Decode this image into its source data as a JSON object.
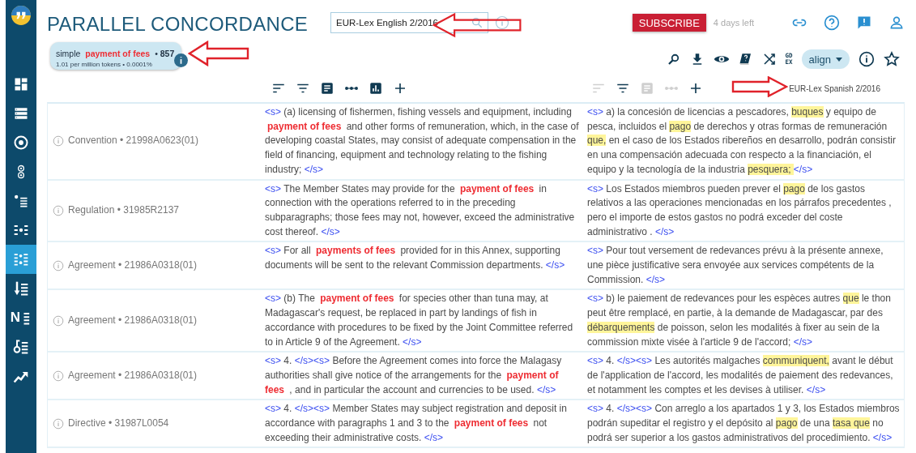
{
  "sidebar": {
    "items": [
      {
        "selected": false
      },
      {
        "selected": false
      },
      {
        "selected": false
      },
      {
        "selected": false
      },
      {
        "selected": false
      },
      {
        "selected": false
      },
      {
        "selected": true
      },
      {
        "selected": false
      },
      {
        "selected": false,
        "glyph": "N"
      },
      {
        "selected": false
      },
      {
        "selected": false
      }
    ]
  },
  "header": {
    "title": "PARALLEL CONCORDANCE",
    "search": {
      "value": "EUR-Lex English 2/2016"
    },
    "subscribe": "SUBSCRIBE",
    "trial": "4 days left"
  },
  "stats": {
    "line1": [
      {
        "kind": "plain",
        "text": "simple "
      },
      {
        "kind": "hit",
        "text": "payment of fees"
      },
      {
        "kind": "plain",
        "text": " • "
      },
      {
        "kind": "bold",
        "text": "857"
      }
    ],
    "line2": "1.01 per million tokens • 0.0001%"
  },
  "tools": {
    "gdex": [
      "GD",
      "EX"
    ],
    "align": "align"
  },
  "toolbars": {
    "left": [
      {
        "disabled": false
      },
      {
        "disabled": false
      },
      {
        "disabled": false
      },
      {
        "disabled": false
      },
      {
        "disabled": false
      },
      {
        "disabled": false
      }
    ],
    "right": [
      {
        "disabled": true
      },
      {
        "disabled": false
      },
      {
        "disabled": true
      },
      {
        "disabled": true
      },
      {
        "disabled": false
      }
    ],
    "right_corpus": "EUR-Lex Spanish 2/2016"
  },
  "rows": [
    {
      "doc": "Convention • 21998A0623(01)",
      "source": [
        {
          "kind": "tag",
          "text": "<s>"
        },
        {
          "kind": "text",
          "text": " (a) licensing of fishermen, fishing vessels and equipment, including "
        },
        {
          "kind": "hit",
          "text": "payment of fees"
        },
        {
          "kind": "text",
          "text": " and other forms of remuneration, which, in the case of developing coastal States, may consist of adequate compensation in the field of financing, equipment and technology relating to the fishing industry; "
        },
        {
          "kind": "tag",
          "text": "</s>"
        }
      ],
      "target": [
        {
          "kind": "tag",
          "text": "<s>"
        },
        {
          "kind": "text",
          "text": "  a) la concesión de licencias a pescadores, "
        },
        {
          "kind": "mark",
          "text": "buques"
        },
        {
          "kind": "text",
          "text": " y equipo de pesca, incluidos el "
        },
        {
          "kind": "mark",
          "text": "pago"
        },
        {
          "kind": "text",
          "text": " de derechos y otras formas de remuneración "
        },
        {
          "kind": "mark",
          "text": "que,"
        },
        {
          "kind": "text",
          "text": " en el caso de los Estados ribereños en desarrollo, podrán consistir en una compensación adecuada con respecto a la financiación, el equipo y la tecnología de la industria "
        },
        {
          "kind": "mark",
          "text": "pesquera; "
        },
        {
          "kind": "tag",
          "text": "</s>"
        }
      ]
    },
    {
      "doc": "Regulation • 31985R2137",
      "source": [
        {
          "kind": "tag",
          "text": "<s>"
        },
        {
          "kind": "text",
          "text": " The Member States may provide for the "
        },
        {
          "kind": "hit",
          "text": "payment of fees"
        },
        {
          "kind": "text",
          "text": " in connection with the operations referred to in the preceding subparagraphs; those fees may not, however, exceed the administrative cost thereof. "
        },
        {
          "kind": "tag",
          "text": "</s>"
        }
      ],
      "target": [
        {
          "kind": "tag",
          "text": "<s>"
        },
        {
          "kind": "text",
          "text": "  Los Estados miembros pueden prever el "
        },
        {
          "kind": "mark",
          "text": "pago"
        },
        {
          "kind": "text",
          "text": " de los gastos relativos a las operaciones mencionadas en los párrafos precedentes , pero el importe de estos gastos no podrá exceder del coste administrativo .  "
        },
        {
          "kind": "tag",
          "text": "</s>"
        }
      ]
    },
    {
      "doc": "Agreement • 21986A0318(01)",
      "source": [
        {
          "kind": "tag",
          "text": "<s>"
        },
        {
          "kind": "text",
          "text": " For all "
        },
        {
          "kind": "hit",
          "text": "payments of fees"
        },
        {
          "kind": "text",
          "text": " provided for in this Annex, supporting documents will be sent to the relevant Commission departments. "
        },
        {
          "kind": "tag",
          "text": "</s>"
        }
      ],
      "target": [
        {
          "kind": "tag",
          "text": "<s>"
        },
        {
          "kind": "text",
          "text": "  Pour tout versement de redevances prévu à la présente annexe, une pièce justificative sera envoyée aux services compétents de la Commission.  "
        },
        {
          "kind": "tag",
          "text": "</s>"
        }
      ]
    },
    {
      "doc": "Agreement • 21986A0318(01)",
      "source": [
        {
          "kind": "tag",
          "text": "<s>"
        },
        {
          "kind": "text",
          "text": " (b) The "
        },
        {
          "kind": "hit",
          "text": "payment of fees"
        },
        {
          "kind": "text",
          "text": " for species other than tuna may, at Madagascar's request, be replaced in part by landings of fish in accordance with procedures to be fixed by the Joint Committee referred to in Article 9 of the Agreement. "
        },
        {
          "kind": "tag",
          "text": "</s>"
        }
      ],
      "target": [
        {
          "kind": "tag",
          "text": "<s>"
        },
        {
          "kind": "text",
          "text": "  b) le paiement de redevances pour les espèces autres "
        },
        {
          "kind": "mark",
          "text": "que"
        },
        {
          "kind": "text",
          "text": " le thon peut être remplacé, en partie, à la demande de Madagascar, par des "
        },
        {
          "kind": "mark",
          "text": "débarquements"
        },
        {
          "kind": "text",
          "text": " de poisson, selon les modalités à fixer au sein de la commission mixte visée à l'article 9 de l'accord;  "
        },
        {
          "kind": "tag",
          "text": "</s>"
        }
      ]
    },
    {
      "doc": "Agreement • 21986A0318(01)",
      "source": [
        {
          "kind": "tag",
          "text": "<s>"
        },
        {
          "kind": "text",
          "text": " 4. "
        },
        {
          "kind": "tag",
          "text": "</s><s>"
        },
        {
          "kind": "text",
          "text": " Before the Agreement comes into force the Malagasy authorities shall give notice of the arrangements for the "
        },
        {
          "kind": "hit",
          "text": "payment of fees"
        },
        {
          "kind": "text",
          "text": " , and in particular the account and currencies to be used. "
        },
        {
          "kind": "tag",
          "text": "</s>"
        }
      ],
      "target": [
        {
          "kind": "tag",
          "text": "<s>"
        },
        {
          "kind": "text",
          "text": "  4. "
        },
        {
          "kind": "tag",
          "text": "</s><s>"
        },
        {
          "kind": "text",
          "text": " Les autorités malgaches "
        },
        {
          "kind": "mark",
          "text": "communiquent,"
        },
        {
          "kind": "text",
          "text": " avant le début de l'application de l'accord, les modalités de paiement des redevances, et notamment les comptes et les devises à utiliser.  "
        },
        {
          "kind": "tag",
          "text": "</s>"
        }
      ]
    },
    {
      "doc": "Directive • 31987L0054",
      "source": [
        {
          "kind": "tag",
          "text": "<s>"
        },
        {
          "kind": "text",
          "text": " 4. "
        },
        {
          "kind": "tag",
          "text": "</s><s>"
        },
        {
          "kind": "text",
          "text": " Member States may subject registration and deposit in accordance with paragraphs 1 and 3 to the "
        },
        {
          "kind": "hit",
          "text": "payment of fees"
        },
        {
          "kind": "text",
          "text": " not exceeding their administrative costs. "
        },
        {
          "kind": "tag",
          "text": "</s>"
        }
      ],
      "target": [
        {
          "kind": "tag",
          "text": "<s>"
        },
        {
          "kind": "text",
          "text": "  4. "
        },
        {
          "kind": "tag",
          "text": "</s><s>"
        },
        {
          "kind": "text",
          "text": " Con arreglo a los apartados 1 y 3, los Estados miembros podrán supeditar el registro y el depósito al "
        },
        {
          "kind": "mark",
          "text": "pago"
        },
        {
          "kind": "text",
          "text": " de una "
        },
        {
          "kind": "mark",
          "text": "tasa que"
        },
        {
          "kind": "text",
          "text": " no podrá ser superior a los gastos administrativos del procedimiento.  "
        },
        {
          "kind": "tag",
          "text": "</s>"
        }
      ]
    }
  ]
}
